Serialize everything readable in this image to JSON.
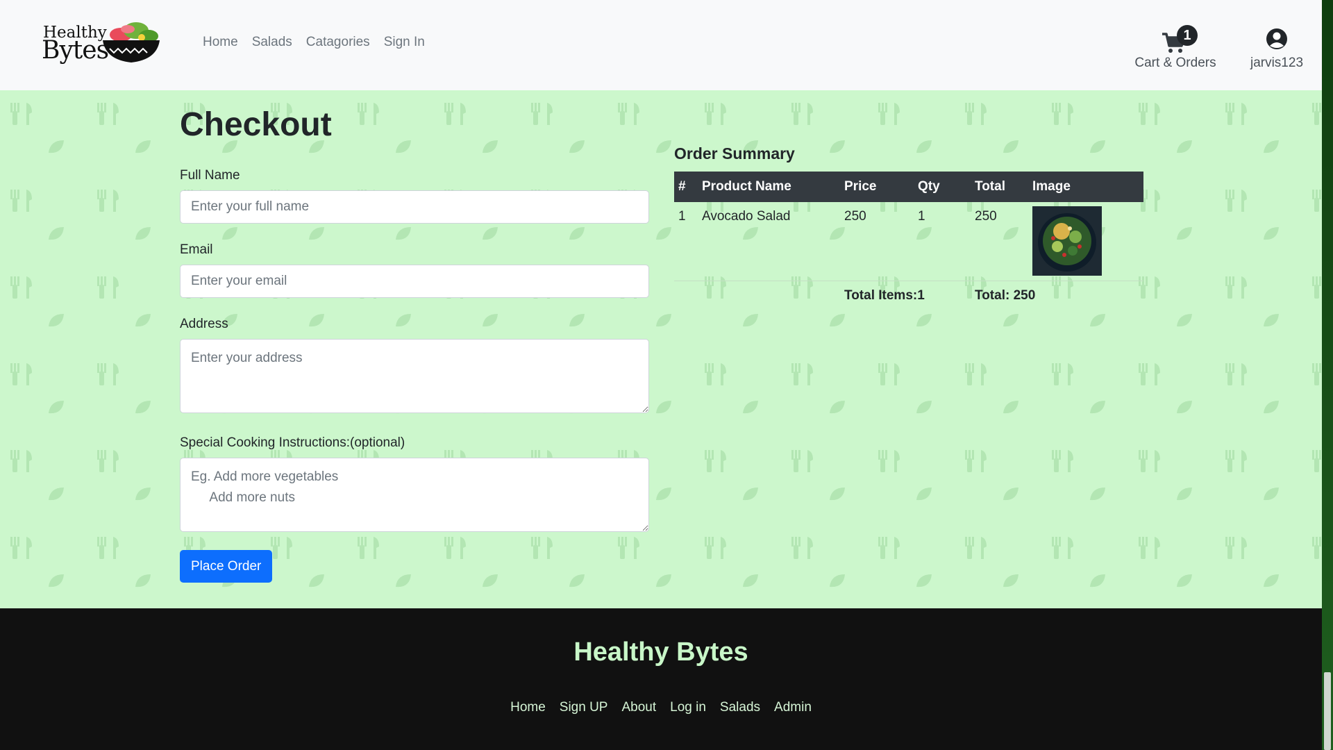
{
  "navbar": {
    "brand_word1": "Healthy",
    "brand_word2": "Bytes",
    "links": [
      "Home",
      "Salads",
      "Catagories",
      "Sign In"
    ],
    "cart_label": "Cart & Orders",
    "cart_count": "1",
    "user_label": "jarvis123",
    "icons": {
      "cart": "cart-icon",
      "user": "user-circle-icon",
      "logo": "salad-bowl-logo"
    }
  },
  "checkout": {
    "title": "Checkout",
    "full_name_label": "Full Name",
    "full_name_placeholder": "Enter your full name",
    "email_label": "Email",
    "email_placeholder": "Enter your email",
    "address_label": "Address",
    "address_placeholder": "Enter your address",
    "instructions_label": "Special Cooking Instructions:(optional)",
    "instructions_placeholder": "Eg. Add more vegetables\n     Add more nuts",
    "submit_label": "Place Order"
  },
  "summary": {
    "title": "Order Summary",
    "headers": [
      "#",
      "Product Name",
      "Price",
      "Qty",
      "Total",
      "Image"
    ],
    "items": [
      {
        "index": "1",
        "name": "Avocado Salad",
        "price": "250",
        "qty": "1",
        "total": "250"
      }
    ],
    "total_items": "Total Items:1",
    "grand_total": "Total: 250"
  },
  "footer": {
    "brand": "Healthy Bytes",
    "links": [
      "Home",
      "Sign UP",
      "About",
      "Log in",
      "Salads",
      "Admin"
    ]
  },
  "colors": {
    "navbar_bg": "#f8f9fa",
    "page_bg": "#ccf7cc",
    "table_header": "#343a40",
    "primary": "#0d6efd",
    "footer_bg": "#111111",
    "footer_text": "#c8f7c8"
  }
}
